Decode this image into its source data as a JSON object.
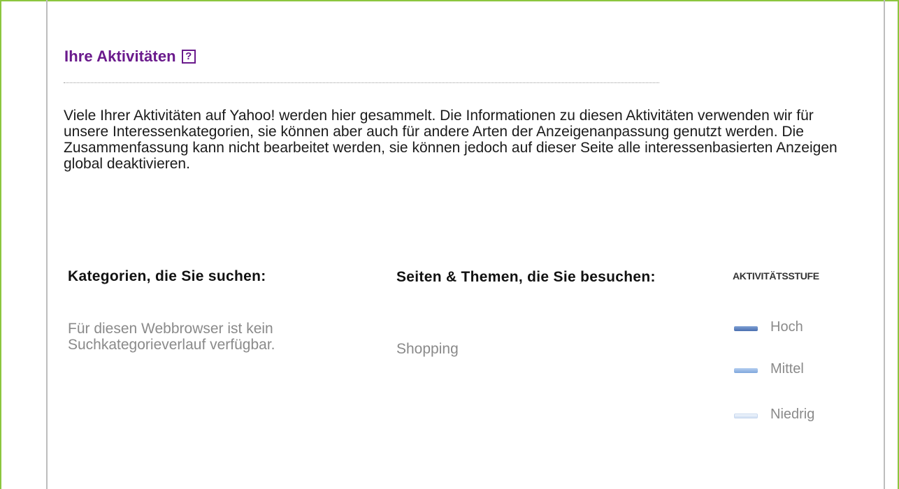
{
  "header": {
    "title": "Ihre Aktivitäten",
    "help_symbol": "?"
  },
  "intro": {
    "text": "Viele Ihrer Aktivitäten auf Yahoo! werden hier gesammelt. Die Informationen zu diesen Aktivitäten verwenden wir für unsere Interessenkategorien, sie können aber auch für andere Arten der Anzeigenanpassung genutzt werden. Die Zusammenfassung kann nicht bearbeitet werden, sie können jedoch auf dieser Seite alle interessenbasierten Anzeigen global deaktivieren."
  },
  "search_categories": {
    "heading": "Kategorien, die Sie suchen:",
    "empty_message": "Für diesen Webbrowser ist kein Suchkategorieverlauf verfügbar."
  },
  "visited_topics": {
    "heading": "Seiten & Themen, die Sie besuchen:",
    "items": [
      "Shopping"
    ]
  },
  "activity_level": {
    "heading": "AKTIVITÄTSSTUFE",
    "levels": [
      {
        "label": "Hoch",
        "color": "#5b7fbd"
      },
      {
        "label": "Mittel",
        "color": "#8fb3e2"
      },
      {
        "label": "Niedrig",
        "color": "#dce8f7"
      }
    ]
  },
  "colors": {
    "frame_border": "#8cc63f",
    "title": "#6a1a8c",
    "muted_text": "#8a8a8a"
  }
}
